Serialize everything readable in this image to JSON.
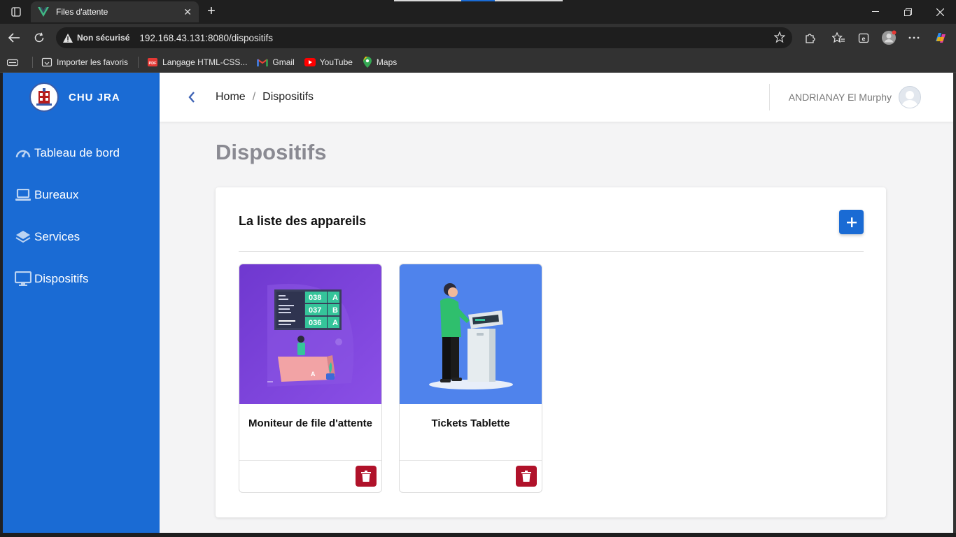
{
  "browser": {
    "tab_title": "Files d'attente",
    "security_label": "Non sécurisé",
    "url": "192.168.43.131:8080/dispositifs",
    "bookmarks": {
      "import": "Importer les favoris",
      "html": "Langage HTML-CSS...",
      "gmail": "Gmail",
      "youtube": "YouTube",
      "maps": "Maps"
    }
  },
  "sidebar": {
    "brand": "CHU JRA",
    "items": [
      {
        "label": "Tableau de bord",
        "icon": "gauge-icon"
      },
      {
        "label": "Bureaux",
        "icon": "laptop-icon"
      },
      {
        "label": "Services",
        "icon": "layers-icon"
      },
      {
        "label": "Dispositifs",
        "icon": "monitor-icon"
      }
    ]
  },
  "header": {
    "breadcrumb_home": "Home",
    "breadcrumb_sep": "/",
    "breadcrumb_current": "Dispositifs",
    "user_name": "ANDRIANAY El Murphy"
  },
  "page": {
    "title": "Dispositifs",
    "panel_title": "La liste des appareils",
    "cards": [
      {
        "title": "Moniteur de file d'attente",
        "illustration": "queue-monitor-illustration",
        "tickets": [
          {
            "number": "038",
            "counter": "A"
          },
          {
            "number": "037",
            "counter": "B"
          },
          {
            "number": "036",
            "counter": "A"
          }
        ],
        "desk_letter": "A"
      },
      {
        "title": "Tickets Tablette",
        "illustration": "ticket-kiosk-illustration"
      }
    ]
  },
  "colors": {
    "sidebar": "#1a6bd4",
    "primary": "#1a6bd4",
    "danger": "#b0122a",
    "card1_bg": "#7b3fd6",
    "card2_bg": "#4f83ec"
  }
}
